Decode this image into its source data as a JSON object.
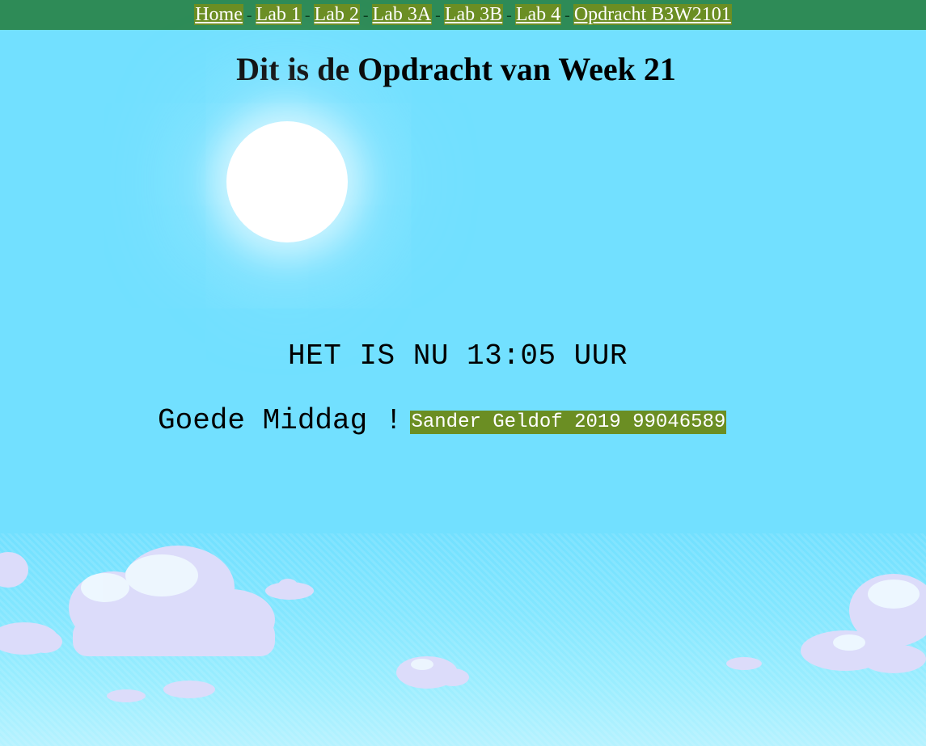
{
  "nav": {
    "links": [
      "Home",
      "Lab 1",
      "Lab 2",
      "Lab 3A",
      "Lab 3B",
      "Lab 4",
      "Opdracht B3W2101"
    ],
    "separator": "-"
  },
  "page": {
    "title": "Dit is de Opdracht van Week 21",
    "time_text": "HET IS NU 13:05 UUR",
    "greeting": "Goede Middag !",
    "author": "Sander Geldof 2019 99046589"
  },
  "colors": {
    "nav_bg": "#2E8B57",
    "link_bg": "#6B8E23",
    "sky": "#72E0FF",
    "sun": "#FFFFFF",
    "cloud": "#DCDCFA"
  },
  "icons": {
    "sun": "sun-icon",
    "clouds": "cloud-icon"
  }
}
